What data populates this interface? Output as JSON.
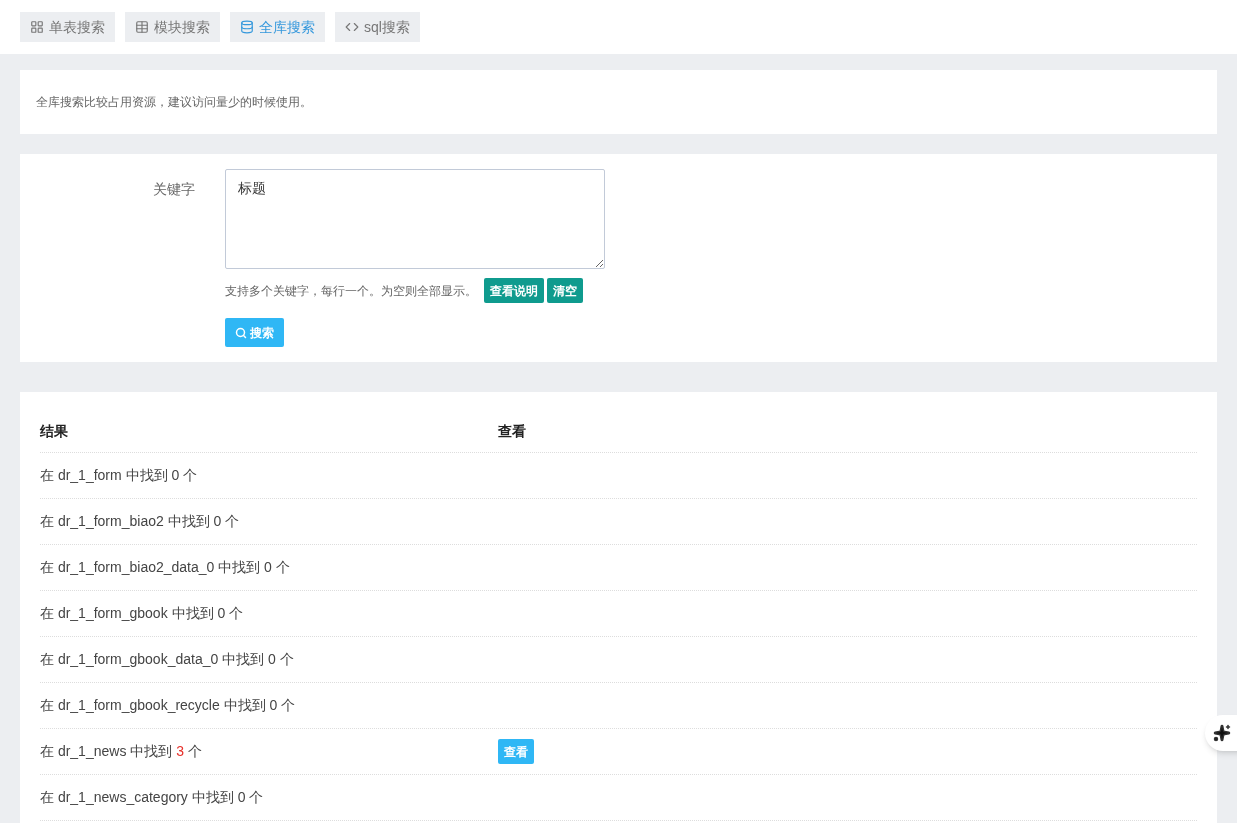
{
  "tabs": [
    {
      "label": "单表搜索",
      "selected": false
    },
    {
      "label": "模块搜索",
      "selected": false
    },
    {
      "label": "全库搜索",
      "selected": true
    },
    {
      "label": "sql搜索",
      "selected": false
    }
  ],
  "notice": "全库搜索比较占用资源，建议访问量少的时候使用。",
  "form": {
    "label": "关键字",
    "value": "标题",
    "help": "支持多个关键字，每行一个。为空则全部显示。",
    "help_buttons": [
      "查看说明",
      "清空"
    ],
    "submit": "搜索"
  },
  "results": {
    "columns": [
      "结果",
      "查看"
    ],
    "rows": [
      {
        "text": "在 dr_1_form 中找到 0 个"
      },
      {
        "text": "在 dr_1_form_biao2 中找到 0 个"
      },
      {
        "text": "在 dr_1_form_biao2_data_0 中找到 0 个"
      },
      {
        "text": "在 dr_1_form_gbook 中找到 0 个"
      },
      {
        "text": "在 dr_1_form_gbook_data_0 中找到 0 个"
      },
      {
        "text": "在 dr_1_form_gbook_recycle 中找到 0 个"
      },
      {
        "text": "在 dr_1_news 中找到 *3* 个",
        "action": "查看"
      },
      {
        "text": "在 dr_1_news_category 中找到 0 个"
      }
    ]
  }
}
